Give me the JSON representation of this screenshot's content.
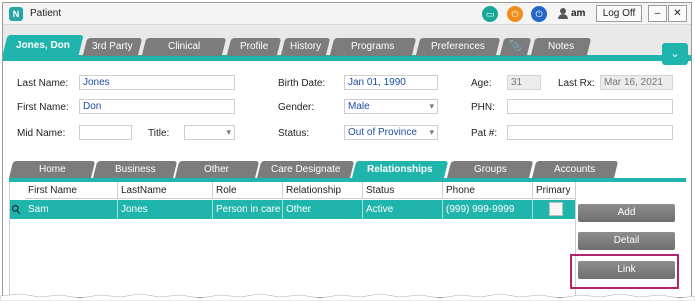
{
  "window": {
    "title": "Patient",
    "app_icon_letter": "N"
  },
  "header": {
    "user": "am",
    "logoff_label": "Log Off",
    "minimize_label": "–",
    "close_label": "✕",
    "icons": [
      "monitor-icon",
      "power-icon",
      "power-icon",
      "user-icon"
    ],
    "accent_colors": {
      "teal": "#1fb5ac",
      "orange": "#f28c1a",
      "blue": "#2466c9"
    }
  },
  "main_tabs": [
    {
      "label": "Jones, Don",
      "active": true
    },
    {
      "label": "3rd Party"
    },
    {
      "label": "Clinical"
    },
    {
      "label": "Profile"
    },
    {
      "label": "History"
    },
    {
      "label": "Programs"
    },
    {
      "label": "Preferences"
    },
    {
      "label": "",
      "icon": "paperclip-icon"
    },
    {
      "label": "Notes"
    }
  ],
  "expand_icon": "double-chevron-down-icon",
  "form": {
    "last_name": {
      "label": "Last Name:",
      "value": "Jones"
    },
    "first_name": {
      "label": "First Name:",
      "value": "Don"
    },
    "mid_name": {
      "label": "Mid Name:",
      "value": ""
    },
    "title": {
      "label": "Title:",
      "value": ""
    },
    "birth_date": {
      "label": "Birth Date:",
      "value": "Jan 01, 1990"
    },
    "gender": {
      "label": "Gender:",
      "value": "Male"
    },
    "status": {
      "label": "Status:",
      "value": "Out of Province"
    },
    "age": {
      "label": "Age:",
      "value": "31"
    },
    "last_rx": {
      "label": "Last Rx:",
      "value": "Mar 16, 2021"
    },
    "phn": {
      "label": "PHN:",
      "value": ""
    },
    "pat_no": {
      "label": "Pat #:",
      "value": ""
    }
  },
  "inner_tabs": [
    {
      "label": "Home"
    },
    {
      "label": "Business"
    },
    {
      "label": "Other"
    },
    {
      "label": "Care Designate"
    },
    {
      "label": "Relationships",
      "active": true
    },
    {
      "label": "Groups"
    },
    {
      "label": "Accounts"
    }
  ],
  "grid": {
    "columns": [
      "First Name",
      "LastName",
      "Role",
      "Relationship",
      "Status",
      "Phone",
      "Primary"
    ],
    "rows": [
      {
        "first_name": "Sam",
        "last_name": "Jones",
        "role": "Person in care",
        "relationship": "Other",
        "status": "Active",
        "phone": "(999) 999-9999",
        "primary": false
      }
    ]
  },
  "actions": {
    "add": "Add",
    "detail": "Detail",
    "link": "Link"
  },
  "highlight_color": "#b0246c"
}
